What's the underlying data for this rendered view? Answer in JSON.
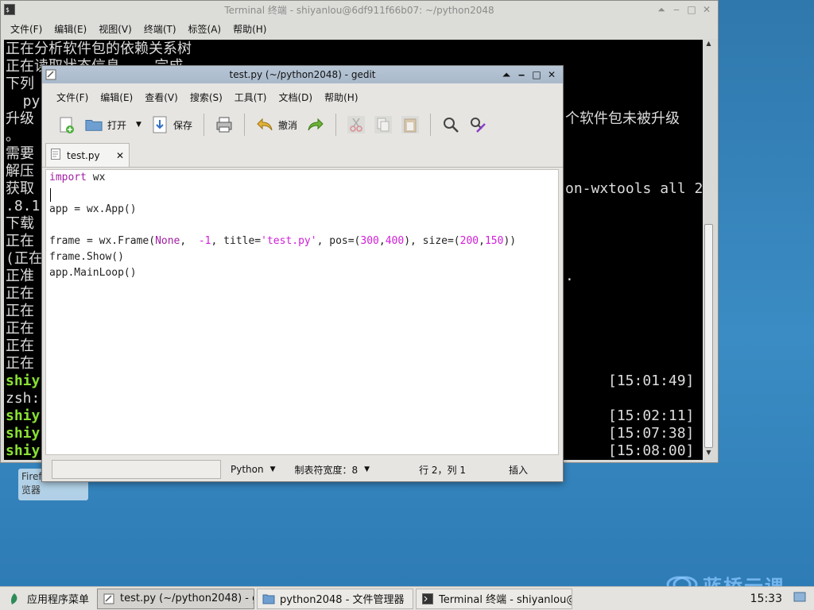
{
  "terminal": {
    "title": "Terminal 终端 - shiyanlou@6df911f66b07: ~/python2048",
    "menu": [
      "文件(F)",
      "编辑(E)",
      "视图(V)",
      "终端(T)",
      "标签(A)",
      "帮助(H)"
    ],
    "lines_left": [
      "正在分析软件包的依赖关系树",
      "正在读取状态信息... 完成",
      "下列",
      "  py",
      "升级",
      "。",
      "需要",
      "解压",
      "获取",
      ".8.1",
      "下载",
      "正在",
      "(正在",
      "正准",
      "正在",
      "正在",
      "正在",
      "正在",
      "正在"
    ],
    "prompt_lines": [
      "shiy",
      "zsh:",
      "shiy",
      "shiy",
      "shiy"
    ],
    "lines_right": [
      "个软件包未被升级",
      "on-wxtools all 2",
      "."
    ],
    "timestamps": [
      "[15:01:49]",
      "[15:02:11]",
      "[15:07:38]",
      "[15:08:00]"
    ]
  },
  "gedit": {
    "title": "test.py (~/python2048) - gedit",
    "menu": [
      "文件(F)",
      "编辑(E)",
      "查看(V)",
      "搜索(S)",
      "工具(T)",
      "文档(D)",
      "帮助(H)"
    ],
    "toolbar": {
      "open": "打开",
      "save": "保存",
      "undo": "撤消"
    },
    "tab": "test.py",
    "code": {
      "l1_kw": "import",
      "l1_rest": " wx",
      "l3": "app = wx.App()",
      "l5_a": "frame = wx.Frame(",
      "l5_none": "None",
      "l5_b": ",  ",
      "l5_neg": "-1",
      "l5_c": ", title=",
      "l5_str": "'test.py'",
      "l5_d": ", pos=(",
      "l5_n300": "300",
      "l5_e": ",",
      "l5_n400": "400",
      "l5_f": "), size=(",
      "l5_n200": "200",
      "l5_g": ",",
      "l5_n150": "150",
      "l5_h": "))",
      "l6": "frame.Show()",
      "l7": "app.MainLoop()"
    },
    "status": {
      "language": "Python",
      "tab_width": "制表符宽度：8",
      "position": "行 2，列 1",
      "mode": "插入"
    }
  },
  "desktop": {
    "icon_label_1": "Firef",
    "icon_label_2": "览器",
    "watermark": "蓝桥云课"
  },
  "taskbar": {
    "app_menu": "应用程序菜单",
    "tasks": [
      "test.py (~/python2048) - g…",
      "python2048 - 文件管理器",
      "Terminal 终端 - shiyanlou@…"
    ],
    "clock": "15:33"
  }
}
